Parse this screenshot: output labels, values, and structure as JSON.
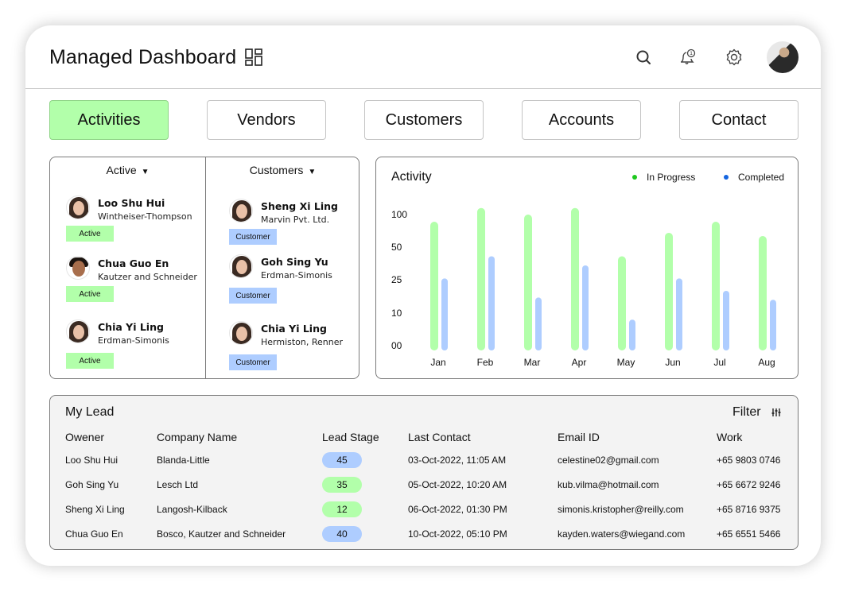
{
  "header": {
    "title": "Managed Dashboard",
    "icons": [
      "layout-grid-icon",
      "search-icon",
      "notification-bell-icon",
      "settings-gear-icon",
      "user-avatar"
    ],
    "notification_count": "1"
  },
  "tabs": [
    {
      "label": "Activities",
      "active": true
    },
    {
      "label": "Vendors",
      "active": false
    },
    {
      "label": "Customers",
      "active": false
    },
    {
      "label": "Accounts",
      "active": false
    },
    {
      "label": "Contact",
      "active": false
    }
  ],
  "people_panel": {
    "left": {
      "filter_label": "Active",
      "people": [
        {
          "name": "Loo Shu Hui",
          "company": "Wintheiser-Thompson",
          "badge": "Active"
        },
        {
          "name": "Chua Guo En",
          "company": "Kautzer and Schneider",
          "badge": "Active"
        },
        {
          "name": "Chia Yi Ling",
          "company": "Erdman-Simonis",
          "badge": "Active"
        }
      ]
    },
    "right": {
      "filter_label": "Customers",
      "people": [
        {
          "name": "Sheng Xi Ling",
          "company": "Marvin Pvt. Ltd.",
          "badge": "Customer"
        },
        {
          "name": "Goh Sing Yu",
          "company": "Erdman-Simonis",
          "badge": "Customer"
        },
        {
          "name": "Chia Yi Ling",
          "company": "Hermiston, Renner",
          "badge": "Customer"
        }
      ]
    }
  },
  "colors": {
    "active_green": "#b2ffaa",
    "customer_blue": "#aecdff",
    "legend_green": "#1ec81e",
    "legend_blue": "#1565e0"
  },
  "chart_data": {
    "type": "bar",
    "title": "Activity",
    "categories": [
      "Jan",
      "Feb",
      "Mar",
      "Apr",
      "May",
      "Jun",
      "Jul",
      "Aug"
    ],
    "series": [
      {
        "name": "In Progress",
        "color": "#b2ffaa",
        "values": [
          89,
          110,
          100,
          110,
          43,
          72,
          89,
          67
        ]
      },
      {
        "name": "Completed",
        "color": "#aecdff",
        "values": [
          26,
          43,
          17,
          36,
          8,
          26,
          20,
          16
        ]
      }
    ],
    "y_ticks": [
      "100",
      "50",
      "25",
      "10",
      "00"
    ],
    "y_tick_values": [
      100,
      50,
      25,
      10,
      0
    ],
    "xlabel": "",
    "ylabel": "",
    "legend_position": "top-right",
    "grid": false
  },
  "lead": {
    "title": "My Lead",
    "filter_label": "Filter",
    "columns": [
      "Owener",
      "Company Name",
      "Lead Stage",
      "Last Contact",
      "Email ID",
      "Work"
    ],
    "rows": [
      {
        "owner": "Loo Shu Hui",
        "company": "Blanda-Little",
        "stage": "45",
        "stage_color": "blue",
        "last_contact": "03-Oct-2022, 11:05 AM",
        "email": "celestine02@gmail.com",
        "work": "+65 9803 0746"
      },
      {
        "owner": "Goh Sing Yu",
        "company": "Lesch Ltd",
        "stage": "35",
        "stage_color": "green",
        "last_contact": "05-Oct-2022, 10:20 AM",
        "email": "kub.vilma@hotmail.com",
        "work": "+65 6672 9246"
      },
      {
        "owner": "Sheng Xi Ling",
        "company": "Langosh-Kilback",
        "stage": "12",
        "stage_color": "green",
        "last_contact": "06-Oct-2022, 01:30 PM",
        "email": "simonis.kristopher@reilly.com",
        "work": "+65 8716 9375"
      },
      {
        "owner": "Chua Guo En",
        "company": "Bosco, Kautzer and Schneider",
        "stage": "40",
        "stage_color": "blue",
        "last_contact": "10-Oct-2022, 05:10 PM",
        "email": "kayden.waters@wiegand.com",
        "work": "+65 6551 5466"
      }
    ]
  }
}
